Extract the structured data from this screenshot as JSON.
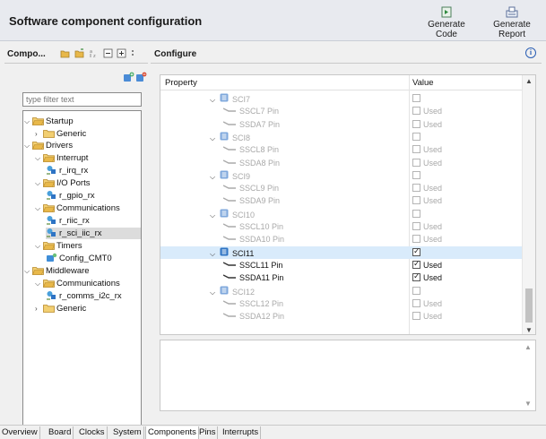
{
  "header": {
    "title": "Software component configuration",
    "generate_code": "Generate Code",
    "generate_report": "Generate Report"
  },
  "components_panel": {
    "title": "Compo...",
    "filter_placeholder": "type filter text",
    "tree": [
      {
        "label": "Startup",
        "type": "folder",
        "expanded": true
      },
      {
        "label": "Generic",
        "type": "folder",
        "expanded": false
      },
      {
        "label": "Drivers",
        "type": "folder",
        "expanded": true
      },
      {
        "label": "Interrupt",
        "type": "folder",
        "expanded": true
      },
      {
        "label": "r_irq_rx",
        "type": "component"
      },
      {
        "label": "I/O Ports",
        "type": "folder",
        "expanded": true
      },
      {
        "label": "r_gpio_rx",
        "type": "component"
      },
      {
        "label": "Communications",
        "type": "folder",
        "expanded": true
      },
      {
        "label": "r_riic_rx",
        "type": "component"
      },
      {
        "label": "r_sci_iic_rx",
        "type": "component",
        "selected": true
      },
      {
        "label": "Timers",
        "type": "folder",
        "expanded": true
      },
      {
        "label": "Config_CMT0",
        "type": "config"
      },
      {
        "label": "Middleware",
        "type": "folder",
        "expanded": true
      },
      {
        "label": "Communications",
        "type": "folder",
        "expanded": true
      },
      {
        "label": "r_comms_i2c_rx",
        "type": "component"
      },
      {
        "label": "Generic",
        "type": "folder",
        "expanded": false
      }
    ]
  },
  "configure_panel": {
    "title": "Configure",
    "col_property": "Property",
    "col_value": "Value",
    "rows": [
      {
        "label": "SCI7",
        "kind": "group",
        "enabled": false,
        "checked": false,
        "value": ""
      },
      {
        "label": "SSCL7 Pin",
        "kind": "pin",
        "enabled": false,
        "checked": false,
        "value": "Used"
      },
      {
        "label": "SSDA7 Pin",
        "kind": "pin",
        "enabled": false,
        "checked": false,
        "value": "Used"
      },
      {
        "label": "SCI8",
        "kind": "group",
        "enabled": false,
        "checked": false,
        "value": ""
      },
      {
        "label": "SSCL8 Pin",
        "kind": "pin",
        "enabled": false,
        "checked": false,
        "value": "Used"
      },
      {
        "label": "SSDA8 Pin",
        "kind": "pin",
        "enabled": false,
        "checked": false,
        "value": "Used"
      },
      {
        "label": "SCI9",
        "kind": "group",
        "enabled": false,
        "checked": false,
        "value": ""
      },
      {
        "label": "SSCL9 Pin",
        "kind": "pin",
        "enabled": false,
        "checked": false,
        "value": "Used"
      },
      {
        "label": "SSDA9 Pin",
        "kind": "pin",
        "enabled": false,
        "checked": false,
        "value": "Used"
      },
      {
        "label": "SCI10",
        "kind": "group",
        "enabled": false,
        "checked": false,
        "value": ""
      },
      {
        "label": "SSCL10 Pin",
        "kind": "pin",
        "enabled": false,
        "checked": false,
        "value": "Used"
      },
      {
        "label": "SSDA10 Pin",
        "kind": "pin",
        "enabled": false,
        "checked": false,
        "value": "Used"
      },
      {
        "label": "SCI11",
        "kind": "group",
        "enabled": true,
        "checked": true,
        "value": "",
        "highlighted": true
      },
      {
        "label": "SSCL11 Pin",
        "kind": "pin",
        "enabled": true,
        "checked": true,
        "value": "Used"
      },
      {
        "label": "SSDA11 Pin",
        "kind": "pin",
        "enabled": true,
        "checked": true,
        "value": "Used"
      },
      {
        "label": "SCI12",
        "kind": "group",
        "enabled": false,
        "checked": false,
        "value": ""
      },
      {
        "label": "SSCL12 Pin",
        "kind": "pin",
        "enabled": false,
        "checked": false,
        "value": "Used"
      },
      {
        "label": "SSDA12 Pin",
        "kind": "pin",
        "enabled": false,
        "checked": false,
        "value": "Used"
      }
    ]
  },
  "bottom_tabs": [
    "Overview",
    "Board",
    "Clocks",
    "System",
    "Components",
    "Pins",
    "Interrupts"
  ],
  "active_tab": "Components",
  "colors": {
    "header_bg": "#e8eaef",
    "folder_yellow": "#e8b84a",
    "selected_row": "#d9ebfb",
    "disabled_text": "#a9a9a9",
    "info_blue": "#2b5fb4"
  }
}
